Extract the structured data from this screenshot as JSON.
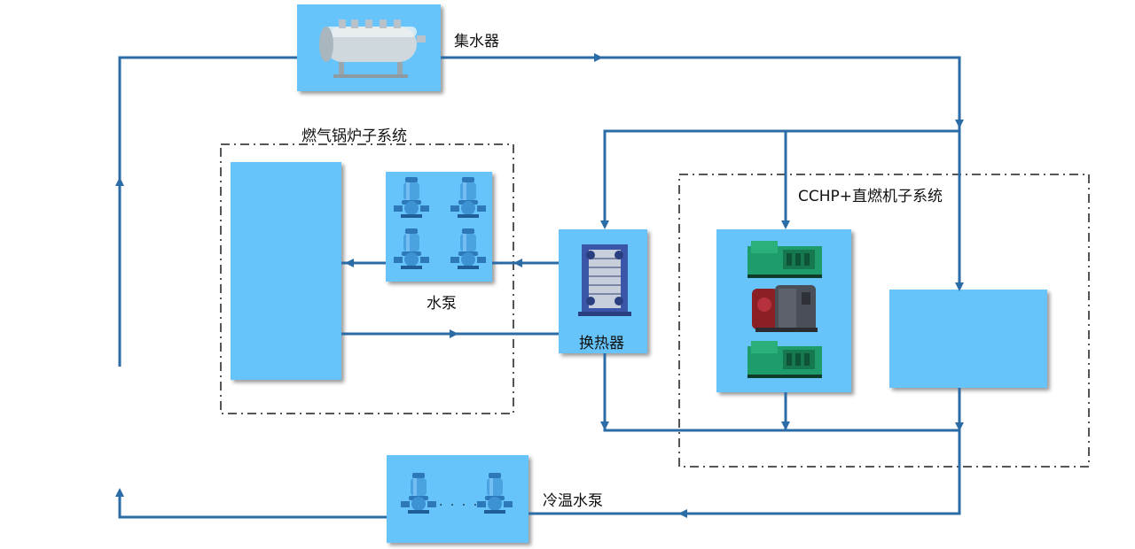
{
  "labels": {
    "header": "集水器",
    "boiler_system": "燃气锅炉子系统",
    "water_pump": "水泵",
    "heat_exchanger": "换热器",
    "cchp_system": "CCHP+直燃机子系统",
    "cold_pump": "冷温水泵",
    "cold_pump_dots": "· · · ·"
  },
  "colors": {
    "pipe": "#2b6ca6",
    "box_fill": "#66c4fa",
    "pump_body": "#3f97d6",
    "generator": "#1e9b6a",
    "exchanger": "#3b56a8",
    "dash": "#555555"
  },
  "icons": [
    "header-tank-icon",
    "pump-icon",
    "generator-icon",
    "absorption-chiller-icon",
    "plate-heat-exchanger-icon"
  ]
}
